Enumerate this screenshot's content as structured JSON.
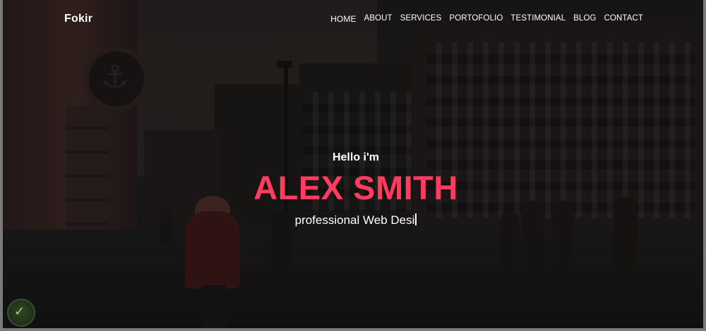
{
  "nav": {
    "brand": "Fokir",
    "items": [
      {
        "label": "HOME"
      },
      {
        "label": "ABOUT"
      },
      {
        "label": "SERVICES"
      },
      {
        "label": "PORTOFOLIO"
      },
      {
        "label": "TESTIMONIAL"
      },
      {
        "label": "BLOG"
      },
      {
        "label": "CONTACT"
      }
    ]
  },
  "hero": {
    "greeting": "Hello i'm",
    "name": "ALEX SMITH",
    "typed_text": "professional Web Desi"
  },
  "colors": {
    "accent": "#ff3b5f",
    "text": "#ffffff"
  },
  "icons": {
    "badge": "shield-icon"
  }
}
